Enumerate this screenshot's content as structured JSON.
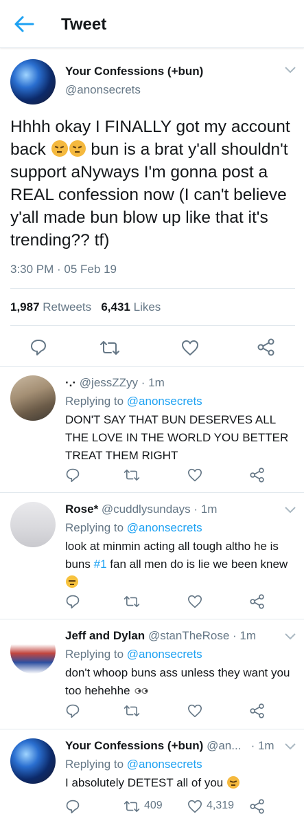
{
  "header": {
    "title": "Tweet"
  },
  "main": {
    "name": "Your Confessions (+bun)",
    "handle": "@anonsecrets",
    "text_1": "Hhhh okay I FINALLY got my account back",
    "text_2": " bun is a brat y'all shouldn't support aNyways I'm gonna post a REAL confession now (I can't believe y'all made bun blow up like that it's trending?? tf)",
    "timestamp": "3:30 PM · 05 Feb 19",
    "retweets_count": "1,987",
    "retweets_label": "Retweets",
    "likes_count": "6,431",
    "likes_label": "Likes"
  },
  "replies": [
    {
      "name": "·.·",
      "handle": "@jessZZyy",
      "time": "· 1m",
      "replying_label": "Replying to",
      "replying_handle": "@anonsecrets",
      "text": "DON'T SAY THAT BUN DESERVES ALL THE LOVE IN THE WORLD YOU BETTER TREAT THEM RIGHT"
    },
    {
      "name": "Rose*",
      "handle": "@cuddlysundays",
      "time": "· 1m",
      "replying_label": "Replying to",
      "replying_handle": "@anonsecrets",
      "text_1": "look at minmin acting all tough altho he is buns",
      "hashtag": "#1",
      "text_2": "fan all men do is lie we been knew"
    },
    {
      "name": "Jeff and Dylan",
      "handle": "@stanTheRose",
      "time": "· 1m",
      "replying_label": "Replying to",
      "replying_handle": "@anonsecrets",
      "text": "don't whoop buns ass unless they want you too hehehhe"
    },
    {
      "name": "Your Confessions (+bun)",
      "handle": "@an...",
      "time": "· 1m",
      "replying_label": "Replying to",
      "replying_handle": "@anonsecrets",
      "text": "I absolutely DETEST all of you",
      "retweets": "409",
      "likes": "4,319"
    }
  ],
  "icons": [
    "back-arrow-icon",
    "chevron-down-icon",
    "reply-icon",
    "retweet-icon",
    "like-icon",
    "share-icon"
  ],
  "colors": {
    "accent": "#1da1f2",
    "secondary_text": "#657786",
    "border": "#e1e8ed"
  }
}
